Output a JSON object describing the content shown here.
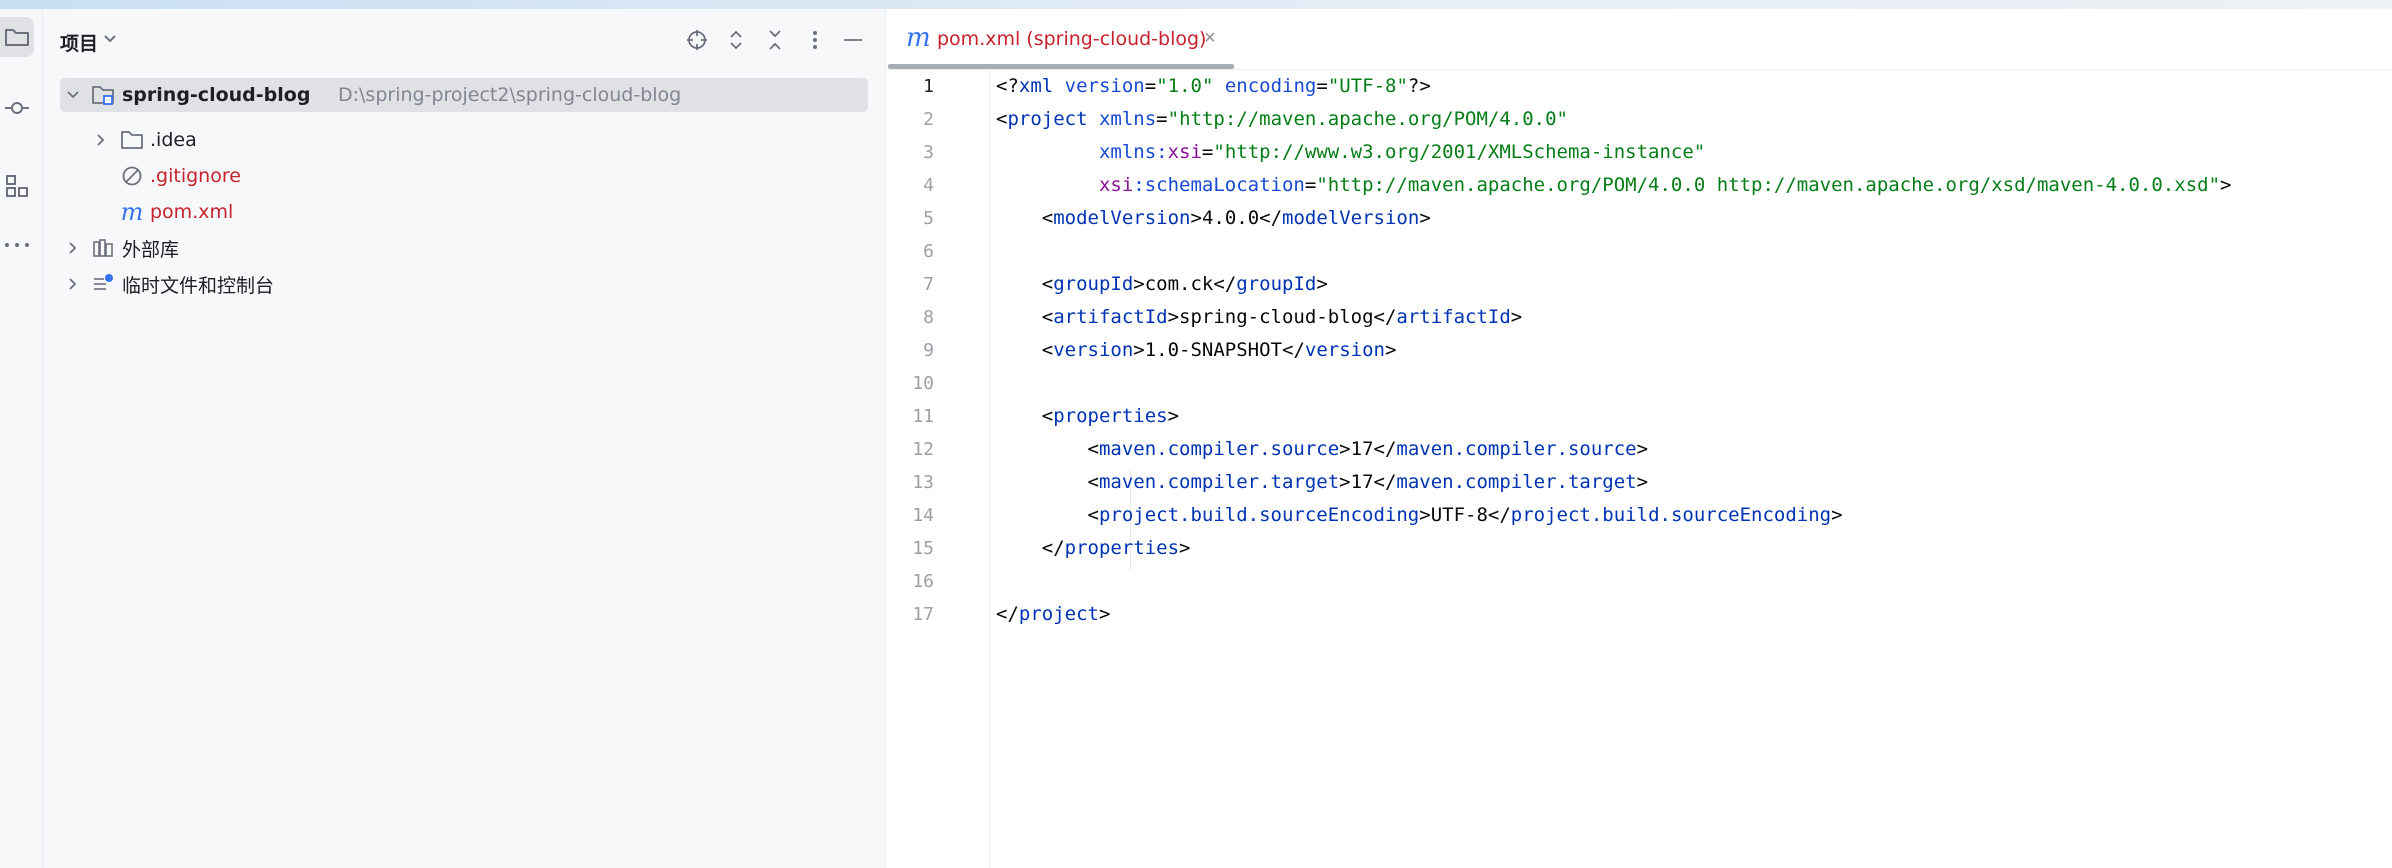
{
  "project_panel": {
    "title": "项目",
    "tree": [
      {
        "name": "spring-cloud-blog",
        "path": "D:\\spring-project2\\spring-cloud-blog"
      },
      {
        "name": ".idea"
      },
      {
        "name": ".gitignore"
      },
      {
        "name": "pom.xml"
      },
      {
        "name": "外部库"
      },
      {
        "name": "临时文件和控制台"
      }
    ]
  },
  "editor": {
    "tab": {
      "icon_letter": "m",
      "label": "pom.xml (spring-cloud-blog)",
      "close": "×"
    },
    "current_line": 1,
    "line_numbers": [
      "1",
      "2",
      "3",
      "4",
      "5",
      "6",
      "7",
      "8",
      "9",
      "10",
      "11",
      "12",
      "13",
      "14",
      "15",
      "16",
      "17"
    ],
    "lines": [
      [
        {
          "t": "<?",
          "c": "t-punc"
        },
        {
          "t": "xml ",
          "c": "t-tag"
        },
        {
          "t": "version",
          "c": "t-attr"
        },
        {
          "t": "=",
          "c": "t-punc"
        },
        {
          "t": "\"1.0\"",
          "c": "t-str"
        },
        {
          "t": " ",
          "c": "t-punc"
        },
        {
          "t": "encoding",
          "c": "t-attr"
        },
        {
          "t": "=",
          "c": "t-punc"
        },
        {
          "t": "\"UTF-8\"",
          "c": "t-str"
        },
        {
          "t": "?>",
          "c": "t-punc"
        }
      ],
      [
        {
          "t": "<",
          "c": "t-punc"
        },
        {
          "t": "project ",
          "c": "t-tag"
        },
        {
          "t": "xmlns",
          "c": "t-attr"
        },
        {
          "t": "=",
          "c": "t-punc"
        },
        {
          "t": "\"http://maven.apache.org/POM/4.0.0\"",
          "c": "t-str"
        }
      ],
      [
        {
          "t": "         ",
          "c": "t-punc"
        },
        {
          "t": "xmlns:",
          "c": "t-attr"
        },
        {
          "t": "xsi",
          "c": "t-ns"
        },
        {
          "t": "=",
          "c": "t-punc"
        },
        {
          "t": "\"http://www.w3.org/2001/XMLSchema-instance\"",
          "c": "t-str"
        }
      ],
      [
        {
          "t": "         ",
          "c": "t-punc"
        },
        {
          "t": "xsi",
          "c": "t-ns"
        },
        {
          "t": ":schemaLocation",
          "c": "t-attr"
        },
        {
          "t": "=",
          "c": "t-punc"
        },
        {
          "t": "\"http://maven.apache.org/POM/4.0.0 http://maven.apache.org/xsd/maven-4.0.0.xsd\"",
          "c": "t-str"
        },
        {
          "t": ">",
          "c": "t-punc"
        }
      ],
      [
        {
          "t": "    <",
          "c": "t-punc"
        },
        {
          "t": "modelVersion",
          "c": "t-tag"
        },
        {
          "t": ">",
          "c": "t-punc"
        },
        {
          "t": "4.0.0",
          "c": "t-txt"
        },
        {
          "t": "</",
          "c": "t-punc"
        },
        {
          "t": "modelVersion",
          "c": "t-tag"
        },
        {
          "t": ">",
          "c": "t-punc"
        }
      ],
      [],
      [
        {
          "t": "    <",
          "c": "t-punc"
        },
        {
          "t": "groupId",
          "c": "t-tag"
        },
        {
          "t": ">",
          "c": "t-punc"
        },
        {
          "t": "com.ck",
          "c": "t-txt"
        },
        {
          "t": "</",
          "c": "t-punc"
        },
        {
          "t": "groupId",
          "c": "t-tag"
        },
        {
          "t": ">",
          "c": "t-punc"
        }
      ],
      [
        {
          "t": "    <",
          "c": "t-punc"
        },
        {
          "t": "artifactId",
          "c": "t-tag"
        },
        {
          "t": ">",
          "c": "t-punc"
        },
        {
          "t": "spring-cloud-blog",
          "c": "t-txt"
        },
        {
          "t": "</",
          "c": "t-punc"
        },
        {
          "t": "artifactId",
          "c": "t-tag"
        },
        {
          "t": ">",
          "c": "t-punc"
        }
      ],
      [
        {
          "t": "    <",
          "c": "t-punc"
        },
        {
          "t": "version",
          "c": "t-tag"
        },
        {
          "t": ">",
          "c": "t-punc"
        },
        {
          "t": "1.0-SNAPSHOT",
          "c": "t-txt"
        },
        {
          "t": "</",
          "c": "t-punc"
        },
        {
          "t": "version",
          "c": "t-tag"
        },
        {
          "t": ">",
          "c": "t-punc"
        }
      ],
      [],
      [
        {
          "t": "    <",
          "c": "t-punc"
        },
        {
          "t": "properties",
          "c": "t-tag"
        },
        {
          "t": ">",
          "c": "t-punc"
        }
      ],
      [
        {
          "t": "        <",
          "c": "t-punc"
        },
        {
          "t": "maven.compiler.source",
          "c": "t-tag"
        },
        {
          "t": ">",
          "c": "t-punc"
        },
        {
          "t": "17",
          "c": "t-txt"
        },
        {
          "t": "</",
          "c": "t-punc"
        },
        {
          "t": "maven.compiler.source",
          "c": "t-tag"
        },
        {
          "t": ">",
          "c": "t-punc"
        }
      ],
      [
        {
          "t": "        <",
          "c": "t-punc"
        },
        {
          "t": "maven.compiler.target",
          "c": "t-tag"
        },
        {
          "t": ">",
          "c": "t-punc"
        },
        {
          "t": "17",
          "c": "t-txt"
        },
        {
          "t": "</",
          "c": "t-punc"
        },
        {
          "t": "maven.compiler.target",
          "c": "t-tag"
        },
        {
          "t": ">",
          "c": "t-punc"
        }
      ],
      [
        {
          "t": "        <",
          "c": "t-punc"
        },
        {
          "t": "project.build.sourceEncoding",
          "c": "t-tag"
        },
        {
          "t": ">",
          "c": "t-punc"
        },
        {
          "t": "UTF-8",
          "c": "t-txt"
        },
        {
          "t": "</",
          "c": "t-punc"
        },
        {
          "t": "project.build.sourceEncoding",
          "c": "t-tag"
        },
        {
          "t": ">",
          "c": "t-punc"
        }
      ],
      [
        {
          "t": "    </",
          "c": "t-punc"
        },
        {
          "t": "properties",
          "c": "t-tag"
        },
        {
          "t": ">",
          "c": "t-punc"
        }
      ],
      [],
      [
        {
          "t": "</",
          "c": "t-punc"
        },
        {
          "t": "project",
          "c": "t-tag"
        },
        {
          "t": ">",
          "c": "t-punc"
        }
      ]
    ]
  },
  "colors": {
    "accent": "#3574f0",
    "vcs_modified": "#c7222d",
    "xml_tag": "#0033b3",
    "xml_string": "#067d17"
  }
}
